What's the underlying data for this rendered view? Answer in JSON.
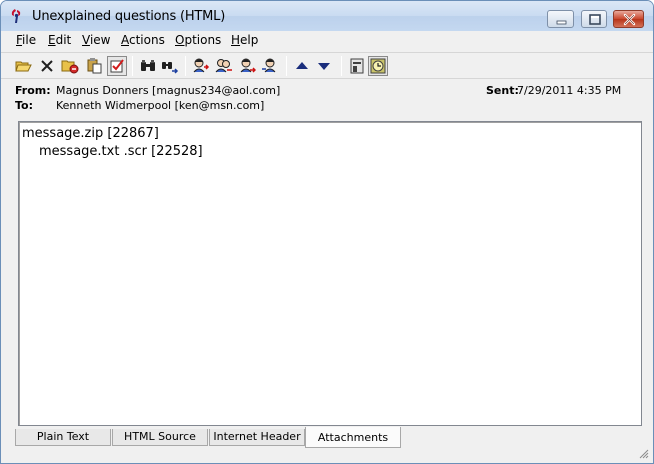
{
  "window": {
    "title": "Unexplained questions (HTML)",
    "icon": "doctor-pen-icon"
  },
  "menu": [
    {
      "key": "F",
      "rest": "ile"
    },
    {
      "key": "E",
      "rest": "dit"
    },
    {
      "key": "V",
      "rest": "iew"
    },
    {
      "key": "A",
      "rest": "ctions"
    },
    {
      "key": "O",
      "rest": "ptions"
    },
    {
      "key": "H",
      "rest": "elp"
    }
  ],
  "toolbar": {
    "icons": [
      "open-folder-icon",
      "delete-icon",
      "save-folder-icon",
      "paste-icon",
      "check-box-icon",
      "find-binoculars-icon",
      "find-next-icon",
      "reply-icon",
      "reply-all-icon",
      "forward-icon",
      "redirect-icon",
      "up-arrow-icon",
      "down-arrow-icon",
      "properties-icon",
      "clock-icon"
    ]
  },
  "header": {
    "from_label": "From:",
    "from_value": "Magnus Donners [magnus234@aol.com]",
    "to_label": "To:",
    "to_value": "Kenneth Widmerpool [ken@msn.com]",
    "sent_label": "Sent:",
    "sent_value": "7/29/2011 4:35 PM"
  },
  "attachments": [
    {
      "text": "message.zip [22867]"
    },
    {
      "text": "message.txt .scr [22528]"
    }
  ],
  "tabs": [
    "Plain Text",
    "HTML Source",
    "Internet Header",
    "Attachments"
  ],
  "active_tab": "Attachments"
}
